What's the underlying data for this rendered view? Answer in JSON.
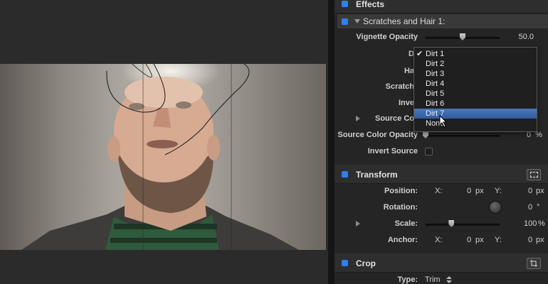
{
  "inspector": {
    "effects_title": "Effects",
    "effect_name": "Scratches and Hair 1:",
    "vignette": {
      "label": "Vignette Opacity",
      "value": "50.0",
      "level": 0.5
    },
    "partial_labels": {
      "dirt": "D",
      "hair": "Ha",
      "scratch": "Scratch",
      "invert": "Inve",
      "source": "Source Co"
    },
    "source_color_opacity": {
      "label": "Source Color Opacity",
      "value": "0",
      "unit": "%",
      "level": 0.0
    },
    "invert_source": {
      "label": "Invert Source"
    },
    "transform": {
      "title": "Transform",
      "position": {
        "label": "Position:",
        "x_label": "X:",
        "x": "0",
        "x_unit": "px",
        "y_label": "Y:",
        "y": "0",
        "y_unit": "px"
      },
      "rotation": {
        "label": "Rotation:",
        "value": "0",
        "unit": "°"
      },
      "scale": {
        "label": "Scale:",
        "value": "100",
        "unit": "%",
        "level": 0.35
      },
      "anchor": {
        "label": "Anchor:",
        "x_label": "X:",
        "x": "0",
        "x_unit": "px",
        "y_label": "Y:",
        "y": "0",
        "y_unit": "px"
      }
    },
    "crop": {
      "title": "Crop",
      "type_label": "Type:",
      "type_value": "Trim"
    }
  },
  "dropdown": {
    "items": [
      "Dirt 1",
      "Dirt 2",
      "Dirt 3",
      "Dirt 4",
      "Dirt 5",
      "Dirt 6",
      "Dirt 7",
      "None"
    ],
    "checked_index": 0,
    "highlighted_index": 6,
    "check_mark": "✔"
  },
  "colors": {
    "accent_blue": "#2f7ff5",
    "highlight": "#3a68ab",
    "panel": "#252525"
  }
}
